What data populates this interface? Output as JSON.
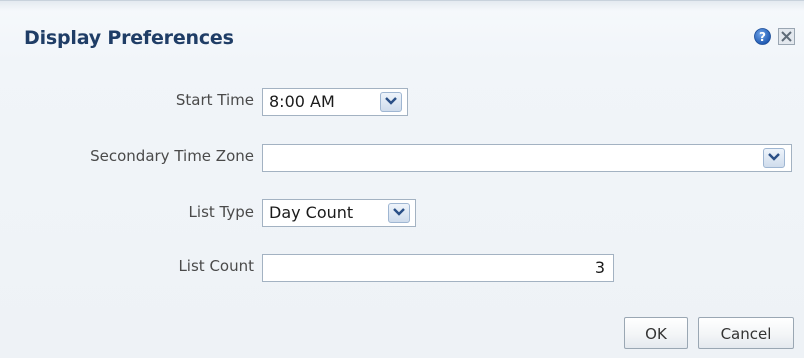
{
  "dialog": {
    "title": "Display Preferences",
    "help_icon": "question-circle-icon",
    "close_icon": "close-x-icon"
  },
  "form": {
    "start_time": {
      "label": "Start Time",
      "value": "8:00 AM"
    },
    "secondary_time_zone": {
      "label": "Secondary Time Zone",
      "value": ""
    },
    "list_type": {
      "label": "List Type",
      "value": "Day Count"
    },
    "list_count": {
      "label": "List Count",
      "value": "3"
    }
  },
  "buttons": {
    "ok": "OK",
    "cancel": "Cancel"
  },
  "colors": {
    "title": "#1f3d66",
    "help_icon": "#2f6fc4",
    "label": "#4a4a4a"
  }
}
